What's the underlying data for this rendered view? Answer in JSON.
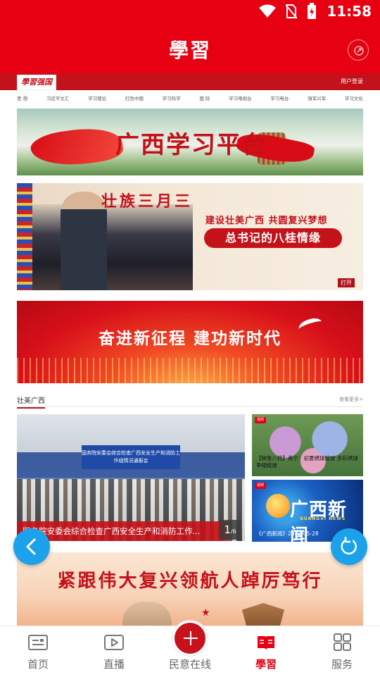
{
  "status_bar": {
    "time": "11:58"
  },
  "header": {
    "title": "學習"
  },
  "site": {
    "logo": "學習强国",
    "user_login": "用户登录",
    "nav": [
      "思 想",
      "习近平文汇",
      "学习理论",
      "红色中国",
      "学习科学",
      "国 际",
      "学习电视台",
      "学习电台",
      "强军兴军",
      "学习文化"
    ]
  },
  "banners": {
    "guangxi": "广西学习平台",
    "zhuang_title": "壮族三月三",
    "zhuang_sub": "建设壮美广西 共圆复兴梦想",
    "zhuang_box": "总书记的八桂情缘",
    "zhuang_open": "打开",
    "fenjin": "奋进新征程 建功新时代",
    "jingen": "紧跟伟大复兴领航人踔厉笃行"
  },
  "section": {
    "title": "壮美广西",
    "more": "查看更多>"
  },
  "feature": {
    "screen_text": "国务院安委会综合检查广西安全生产和消防工作组情况通报会",
    "caption": "国务院安委会综合检查广西安全生产和消防工作...",
    "counter_current": "1",
    "counter_total": "/6"
  },
  "side_cards": [
    {
      "badge": "视频",
      "caption": "【映象八桂】南宁：初夏绣球绽放 多彩绣球争相绽放"
    },
    {
      "badge": "视频",
      "logo": "广西新闻",
      "logo_sub": "GUANGXI NEWS",
      "caption": "《广西新闻》2022-05-28"
    }
  ],
  "tabs": [
    {
      "label": "首页"
    },
    {
      "label": "直播"
    },
    {
      "label": "民意在线"
    },
    {
      "label": "學習"
    },
    {
      "label": "服务"
    }
  ],
  "colors": {
    "brand_red": "#e60012",
    "fab_blue": "#1ba2ea"
  }
}
